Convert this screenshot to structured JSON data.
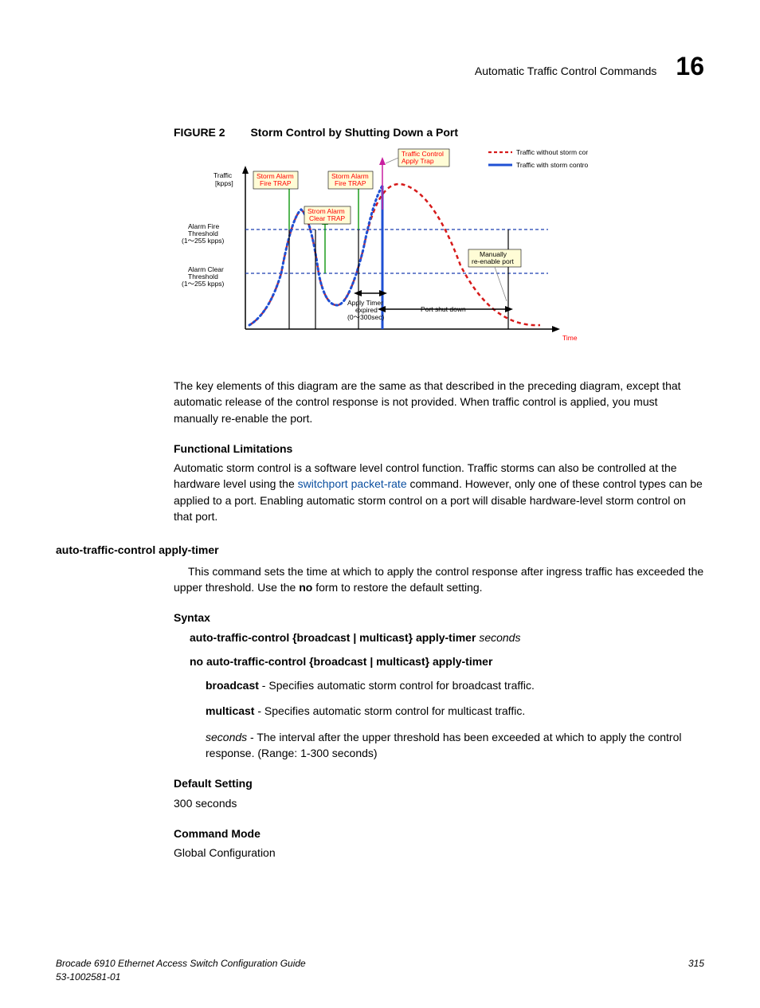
{
  "header": {
    "title": "Automatic Traffic Control Commands",
    "chapter": "16"
  },
  "figure": {
    "label": "FIGURE 2",
    "title": "Storm Control by Shutting Down a Port"
  },
  "diagram": {
    "legend_without": "Traffic without storm control",
    "legend_with": "Traffic with storm control",
    "traffic_control_apply_trap": "Traffic Control Apply Trap",
    "storm_alarm_fire_trap": "Storm Alarm Fire TRAP",
    "storm_alarm_clear_trap": "Strom Alarm Clear TRAP",
    "y_axis": "Traffic [kpps]",
    "alarm_fire_threshold": "Alarm Fire Threshold (1～255 kpps)",
    "alarm_clear_threshold": "Alarm Clear Threshold (1～255 kpps)",
    "apply_timer_expired": "Apply Timer expired (0～300sec)",
    "port_shut_down": "Port shut down",
    "manually_reenable": "Manually re-enable port",
    "time": "Time"
  },
  "para1": "The key elements of this diagram are the same as that described in the preceding diagram, except that automatic release of the control response is not provided. When traffic control is applied, you must manually re-enable the port.",
  "functional_limitations_head": "Functional Limitations",
  "functional_limitations_text_pre": "Automatic storm control is a software level control function. Traffic storms can also be controlled at the hardware level using the ",
  "functional_limitations_link": "switchport packet-rate",
  "functional_limitations_text_post": " command. However, only one of these control types can be applied to a port. Enabling automatic storm control on a port will disable hardware-level storm control on that port.",
  "cmd_head": "auto-traffic-control apply-timer",
  "cmd_desc_pre": "This command sets the time at which to apply the control response after ingress traffic has exceeded the upper threshold. Use the ",
  "cmd_desc_bold": "no",
  "cmd_desc_post": " form to restore the default setting.",
  "syntax_head": "Syntax",
  "syntax_line1_bold": "auto-traffic-control {broadcast | multicast} apply-timer",
  "syntax_line1_italic": "seconds",
  "syntax_line2": "no auto-traffic-control {broadcast | multicast} apply-timer",
  "param_broadcast_bold": "broadcast",
  "param_broadcast_text": " - Specifies automatic storm control for broadcast traffic.",
  "param_multicast_bold": "multicast",
  "param_multicast_text": " - Specifies automatic storm control for multicast traffic.",
  "param_seconds_italic": "seconds",
  "param_seconds_text": " - The interval after the upper threshold has been exceeded at which to apply the control response. (Range: 1-300 seconds)",
  "default_setting_head": "Default Setting",
  "default_setting_text": "300 seconds",
  "command_mode_head": "Command Mode",
  "command_mode_text": "Global Configuration",
  "footer": {
    "left_line1": "Brocade 6910 Ethernet Access Switch Configuration Guide",
    "left_line2": "53-1002581-01",
    "right": "315"
  }
}
